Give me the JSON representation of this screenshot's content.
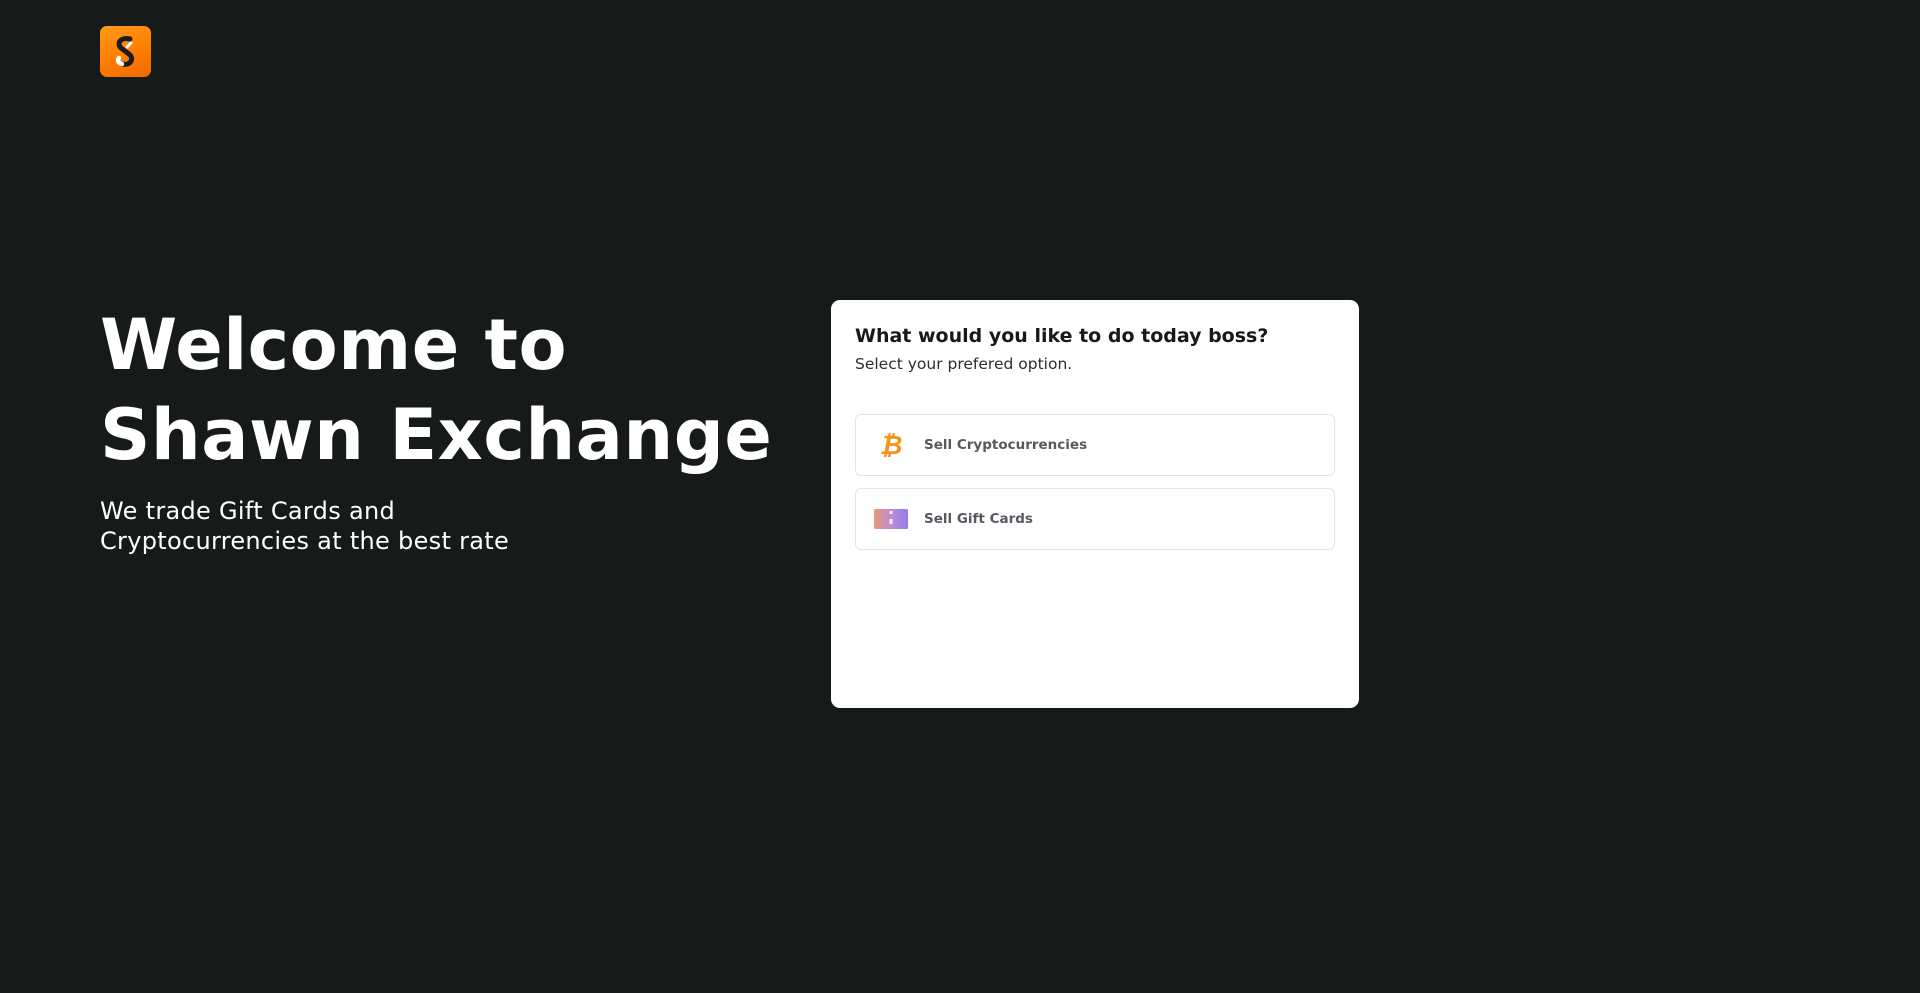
{
  "header": {
    "logo_icon": "shawn-exchange-logo-icon"
  },
  "hero": {
    "title_line1": "Welcome to",
    "title_line2": "Shawn Exchange",
    "subtitle": "We trade Gift Cards and Cryptocurrencies at the best rate"
  },
  "card": {
    "title": "What would you like to do today boss?",
    "subtitle": "Select your prefered option.",
    "options": [
      {
        "label": "Sell Cryptocurrencies",
        "icon": "bitcoin-icon"
      },
      {
        "label": "Sell Gift Cards",
        "icon": "gift-card-icon"
      }
    ]
  },
  "colors": {
    "background": "#161b1a",
    "accent": "#ff7a00",
    "bitcoin": "#f7931a",
    "card_background": "#ffffff"
  }
}
